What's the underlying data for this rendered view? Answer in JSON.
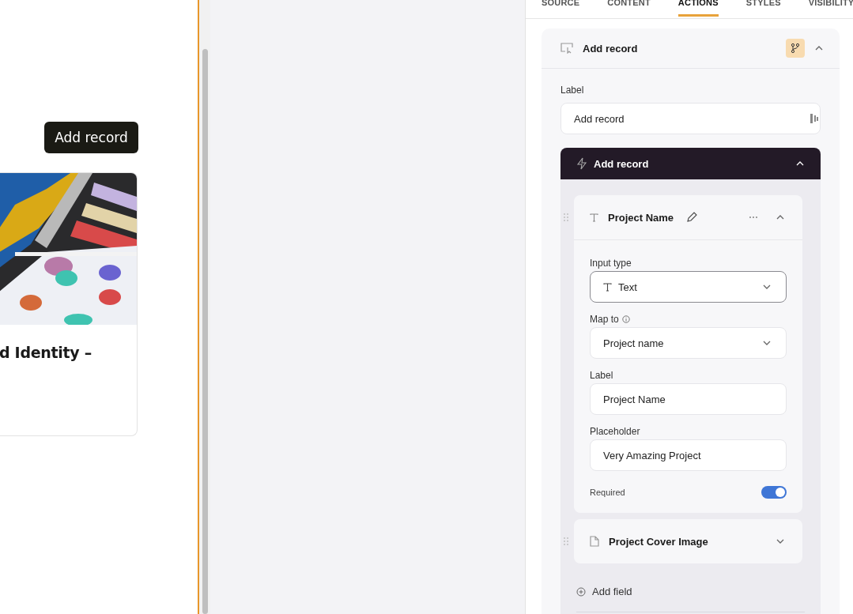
{
  "canvas": {
    "button": "Add record",
    "card": {
      "title": "d Identity –"
    }
  },
  "panel": {
    "tabs": [
      {
        "label": "SOURCE",
        "selected": false
      },
      {
        "label": "CONTENT",
        "selected": false
      },
      {
        "label": "ACTIONS",
        "selected": true
      },
      {
        "label": "STYLES",
        "selected": false
      },
      {
        "label": "VISIBILITY",
        "selected": false
      }
    ],
    "action": {
      "title": "Add record",
      "expanded": true,
      "label_field": {
        "label": "Label",
        "value": "Add record"
      },
      "step": {
        "title": "Add record",
        "expanded": true,
        "fields": [
          {
            "kind": "text",
            "title": "Project Name",
            "expanded": true,
            "input_type": {
              "label": "Input type",
              "value": "Text"
            },
            "map_to": {
              "label": "Map to",
              "value": "Project name"
            },
            "label": {
              "label": "Label",
              "value": "Project Name"
            },
            "placeholder": {
              "label": "Placeholder",
              "value": "Very Amazing Project"
            },
            "required": {
              "label": "Required",
              "on": true
            }
          },
          {
            "kind": "file",
            "title": "Project Cover Image",
            "expanded": false
          }
        ],
        "add_field": "Add field"
      }
    }
  }
}
